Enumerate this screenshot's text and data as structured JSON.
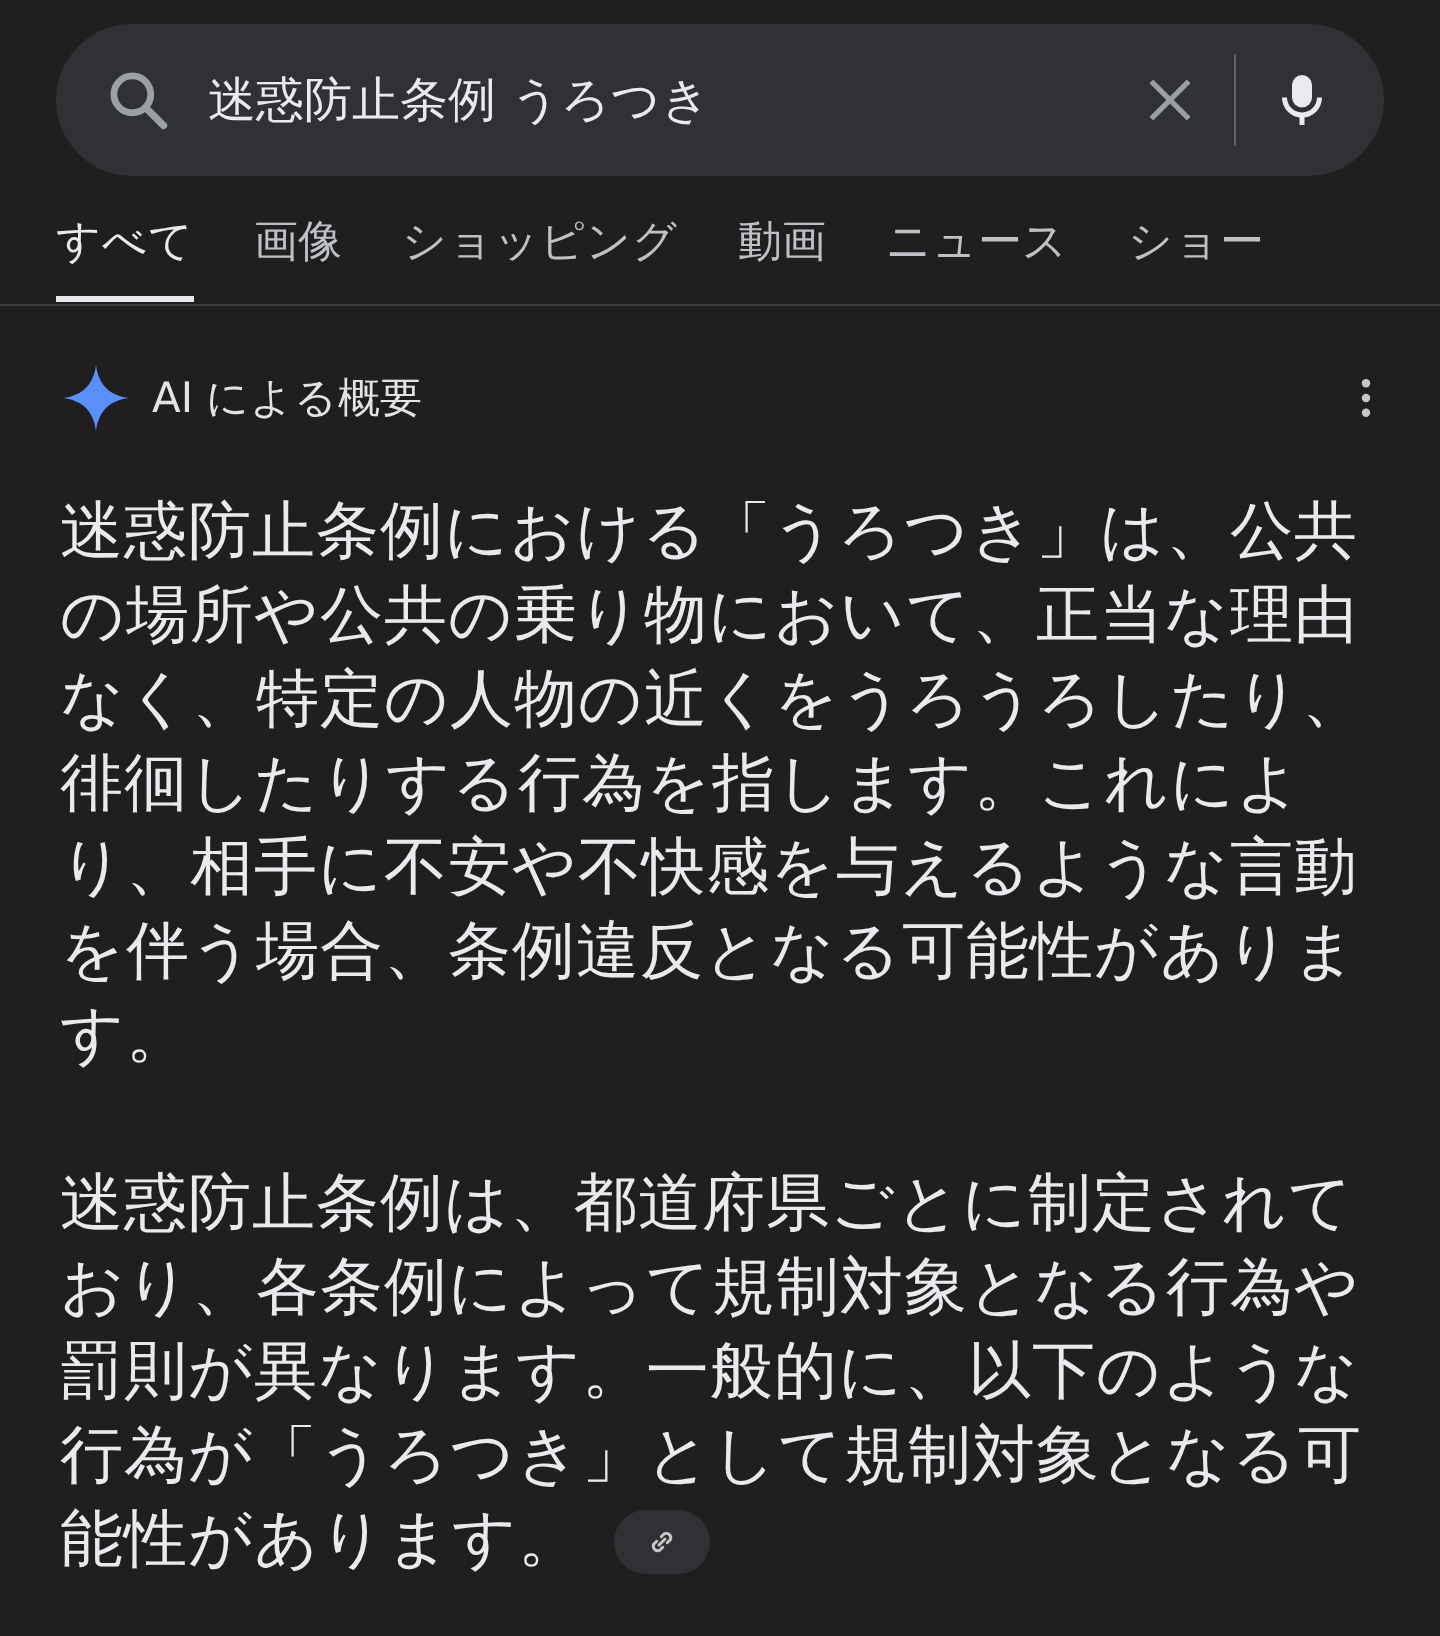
{
  "search": {
    "value": "迷惑防止条例 うろつき"
  },
  "tabs": [
    {
      "label": "すべて",
      "selected": true
    },
    {
      "label": "画像",
      "selected": false
    },
    {
      "label": "ショッピング",
      "selected": false
    },
    {
      "label": "動画",
      "selected": false
    },
    {
      "label": "ニュース",
      "selected": false
    },
    {
      "label": "ショー",
      "selected": false
    }
  ],
  "overview": {
    "title": "AI による概要",
    "paragraphs": [
      "迷惑防止条例における「うろつき」は、公共の場所や公共の乗り物において、正当な理由なく、特定の人物の近くをうろうろしたり、徘徊したりする行為を指します。これにより、相手に不安や不快感を与えるような言動を伴う場合、条例違反となる可能性があります。",
      "迷惑防止条例は、都道府県ごとに制定されており、各条例によって規制対象となる行為や罰則が異なります。一般的に、以下のような行為が「うろつき」として規制対象となる可能性があります。"
    ]
  }
}
